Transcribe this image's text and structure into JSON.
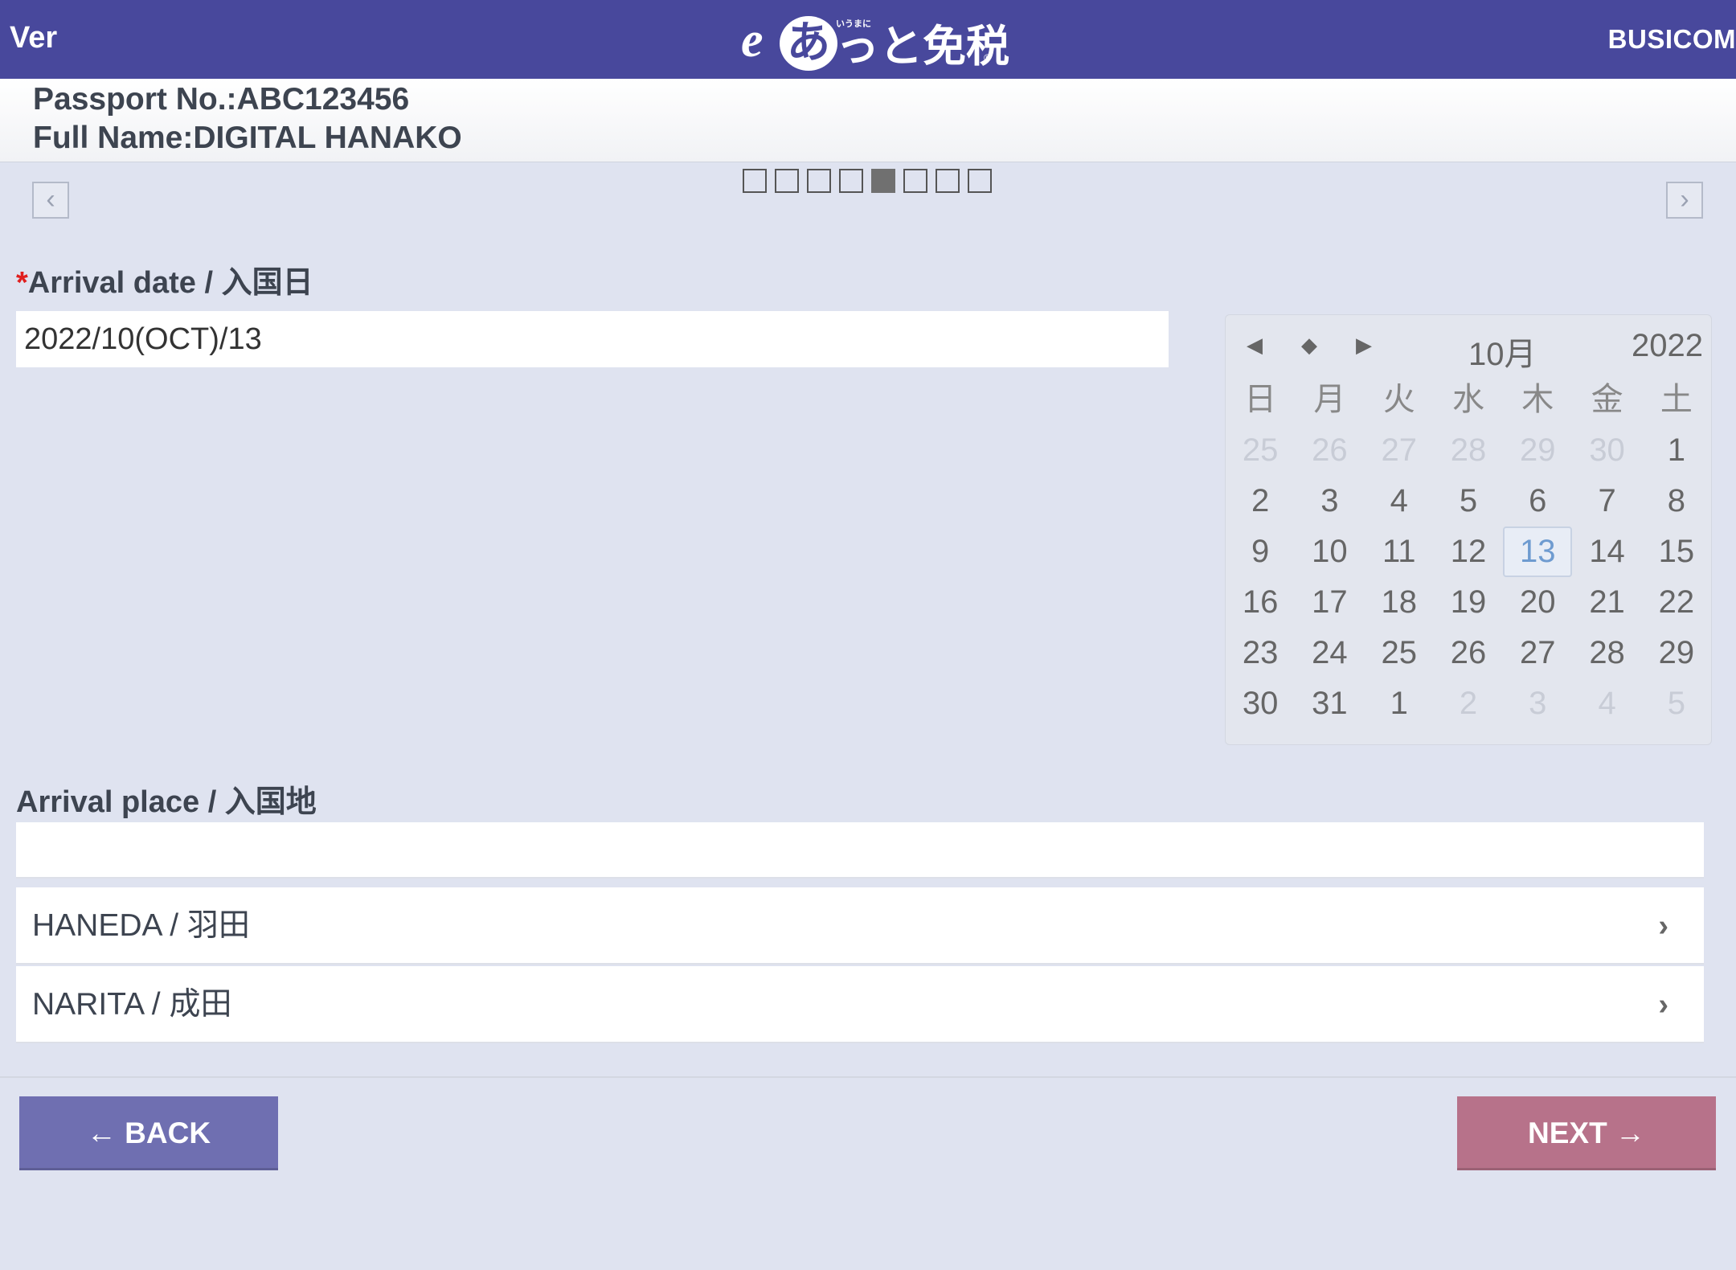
{
  "header": {
    "ver_label": "Ver",
    "logo_e": "e",
    "logo_a": "あ",
    "logo_rest": "っと免税",
    "logo_small": "いうまに",
    "logo_reg": "®",
    "brand": "BUSICOM"
  },
  "traveler": {
    "passport_line": "Passport No.:ABC123456",
    "name_line": "Full Name:DIGITAL HANAKO"
  },
  "pager": {
    "prev_icon": "chevron-left-icon",
    "next_icon": "chevron-right-icon",
    "total_steps": 8,
    "current_step": 5
  },
  "arrival_date": {
    "required_mark": "*",
    "label": "Arrival date / 入国日",
    "value": "2022/10(OCT)/13"
  },
  "calendar": {
    "prev_symbol": "◀",
    "today_symbol": "◆",
    "next_symbol": "▶",
    "month": "10月",
    "year": "2022",
    "weekdays": [
      "日",
      "月",
      "火",
      "水",
      "木",
      "金",
      "土"
    ],
    "days": [
      "25",
      "26",
      "27",
      "28",
      "29",
      "30",
      "1",
      "2",
      "3",
      "4",
      "5",
      "6",
      "7",
      "8",
      "9",
      "10",
      "11",
      "12",
      "13",
      "14",
      "15",
      "16",
      "17",
      "18",
      "19",
      "20",
      "21",
      "22",
      "23",
      "24",
      "25",
      "26",
      "27",
      "28",
      "29",
      "30",
      "31",
      "1",
      "2",
      "3",
      "4",
      "5"
    ],
    "selected_day": "13"
  },
  "arrival_place": {
    "label": "Arrival place / 入国地",
    "value": "",
    "options": [
      "HANEDA / 羽田",
      "NARITA / 成田"
    ],
    "chevron": "›"
  },
  "buttons": {
    "back": "← BACK",
    "next": "NEXT →"
  },
  "colors": {
    "header_bg": "#48489c",
    "page_bg": "#dfe3f0",
    "back_button": "#6f6fb1",
    "next_button": "#b7728a",
    "required": "#e01f1f"
  }
}
